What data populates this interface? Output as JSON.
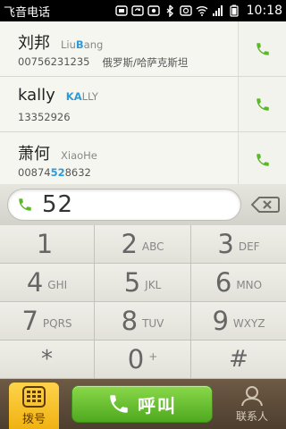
{
  "status_bar": {
    "app_title": "飞音电话",
    "time": "10:18",
    "icons": [
      "usb-icon",
      "sync-icon",
      "screenshot-icon",
      "bluetooth-icon",
      "alarm-icon",
      "wifi-icon",
      "signal-icon",
      "battery-icon"
    ]
  },
  "results": [
    {
      "name": "刘邦",
      "pinyin_parts": [
        "Liu",
        "B",
        "ang"
      ],
      "pinyin_highlight": 1,
      "number": "00756231235",
      "location": "俄罗斯/哈萨克斯坦"
    },
    {
      "name": "kally",
      "pinyin_parts": [
        "",
        "KA",
        "LLY"
      ],
      "pinyin_highlight": 1,
      "number": "13352926",
      "location": ""
    },
    {
      "name": "萧何",
      "pinyin_parts": [
        "XiaoHe",
        "",
        ""
      ],
      "pinyin_highlight": -1,
      "number_parts": [
        "00874",
        "52",
        "8632"
      ],
      "location": ""
    }
  ],
  "dial_input": {
    "value": "52"
  },
  "keypad": [
    {
      "digit": "1",
      "letters": ""
    },
    {
      "digit": "2",
      "letters": "ABC"
    },
    {
      "digit": "3",
      "letters": "DEF"
    },
    {
      "digit": "4",
      "letters": "GHI"
    },
    {
      "digit": "5",
      "letters": "JKL"
    },
    {
      "digit": "6",
      "letters": "MNO"
    },
    {
      "digit": "7",
      "letters": "PQRS"
    },
    {
      "digit": "8",
      "letters": "TUV"
    },
    {
      "digit": "9",
      "letters": "WXYZ"
    },
    {
      "digit": "*",
      "letters": ""
    },
    {
      "digit": "0",
      "letters": "+"
    },
    {
      "digit": "#",
      "letters": ""
    }
  ],
  "bottom_bar": {
    "dial_tab_label": "拨号",
    "call_label": "呼叫",
    "contacts_tab_label": "联系人"
  },
  "colors": {
    "accent_green": "#5cb82a",
    "highlight_blue": "#2e9ad6",
    "dial_tab_yellow": "#f5c22a",
    "bottom_bar_brown": "#5e4c3a"
  }
}
